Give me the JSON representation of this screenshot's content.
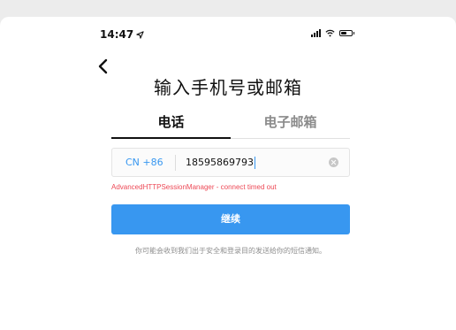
{
  "status_bar": {
    "time": "14:47",
    "location_icon": "location-arrow-icon",
    "signal_icon": "signal-icon",
    "wifi_icon": "wifi-icon",
    "battery_icon": "battery-icon"
  },
  "nav": {
    "back_icon": "chevron-left-icon"
  },
  "page": {
    "title": "输入手机号或邮箱"
  },
  "tabs": [
    {
      "label": "电话",
      "selected": true
    },
    {
      "label": "电子邮箱",
      "selected": false
    }
  ],
  "phone_input": {
    "country_code": "CN +86",
    "value": "18595869793",
    "clear_icon": "clear-circle-icon"
  },
  "error": {
    "message": "AdvancedHTTPSessionManager - connect timed out"
  },
  "next_button": {
    "label": "继续"
  },
  "note": {
    "text": "你可能会收到我们出于安全和登录目的发送给你的短信通知。"
  },
  "colors": {
    "accent": "#3897f0",
    "error": "#ed4956",
    "muted": "#8e8e8e"
  }
}
